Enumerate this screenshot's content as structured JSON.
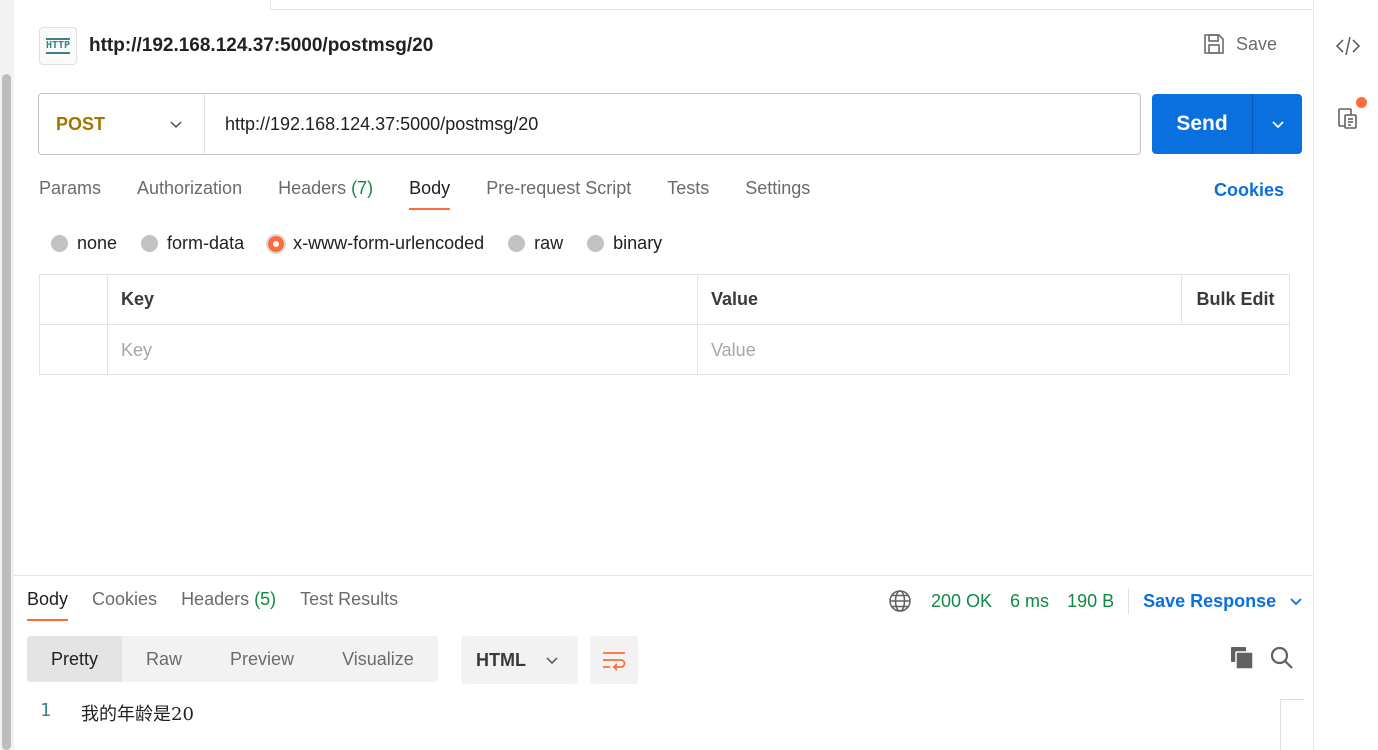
{
  "header": {
    "badge": "HTTP",
    "title": "http://192.168.124.37:5000/postmsg/20",
    "save_label": "Save"
  },
  "request": {
    "method": "POST",
    "url": "http://192.168.124.37:5000/postmsg/20",
    "send_label": "Send"
  },
  "req_tabs": {
    "params": "Params",
    "authorization": "Authorization",
    "headers": "Headers",
    "headers_count": "(7)",
    "body": "Body",
    "prerequest": "Pre-request Script",
    "tests": "Tests",
    "settings": "Settings",
    "cookies": "Cookies"
  },
  "body_modes": {
    "none": "none",
    "form_data": "form-data",
    "urlencoded": "x-www-form-urlencoded",
    "raw": "raw",
    "binary": "binary",
    "selected": "x-www-form-urlencoded"
  },
  "kv_table": {
    "key_header": "Key",
    "value_header": "Value",
    "bulk_edit": "Bulk Edit",
    "key_placeholder": "Key",
    "value_placeholder": "Value"
  },
  "response": {
    "tabs": {
      "body": "Body",
      "cookies": "Cookies",
      "headers": "Headers",
      "headers_count": "(5)",
      "test_results": "Test Results"
    },
    "status": "200 OK",
    "time": "6 ms",
    "size": "190 B",
    "save_response": "Save Response",
    "views": {
      "pretty": "Pretty",
      "raw": "Raw",
      "preview": "Preview",
      "visualize": "Visualize"
    },
    "format": "HTML",
    "lines": [
      {
        "number": "1",
        "text": "我的年龄是20"
      }
    ]
  },
  "colors": {
    "accent": "#ff6c37",
    "primary": "#0a6fdf",
    "success": "#0f8a43",
    "method": "#a47400"
  }
}
